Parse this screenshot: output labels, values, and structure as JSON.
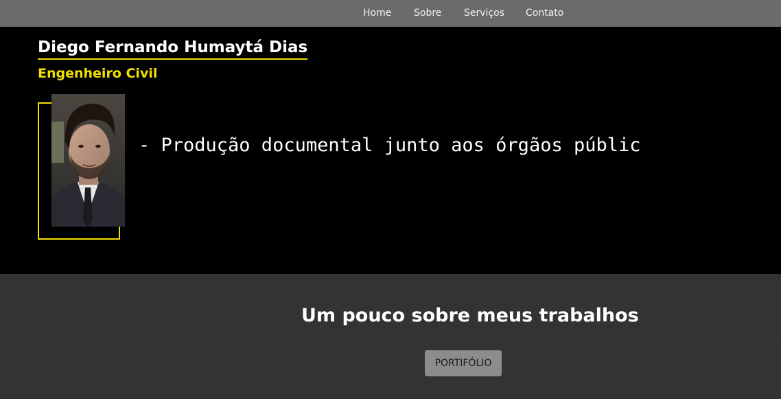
{
  "nav": {
    "items": [
      {
        "label": "Home"
      },
      {
        "label": "Sobre"
      },
      {
        "label": "Serviços"
      },
      {
        "label": "Contato"
      }
    ]
  },
  "hero": {
    "name": "Diego Fernando Humaytá Dias",
    "role": "Engenheiro Civil",
    "typing_text": "- Produção documental junto aos órgãos públic",
    "accent_color": "#f2e000"
  },
  "about": {
    "title": "Um pouco sobre meus trabalhos",
    "button_label": "PORTIFÓLIO"
  }
}
